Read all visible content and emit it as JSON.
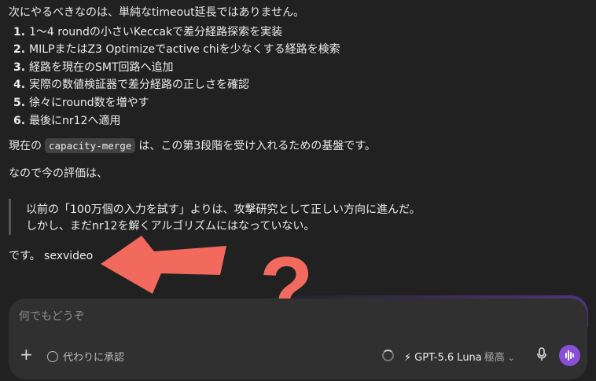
{
  "message": {
    "intro": "次にやるべきなのは、単純なtimeout延長ではありません。",
    "steps": [
      {
        "num": "1.",
        "text": "1〜4 roundの小さいKeccakで差分経路探索を実装"
      },
      {
        "num": "2.",
        "text": "MILPまたはZ3 Optimizeでactive chiを少なくする経路を検索"
      },
      {
        "num": "3.",
        "text": "経路を現在のSMT回路へ追加"
      },
      {
        "num": "4.",
        "text": "実際の数値検証器で差分経路の正しさを確認"
      },
      {
        "num": "5.",
        "text": "徐々にround数を増やす"
      },
      {
        "num": "6.",
        "text": "最後にnr12へ適用"
      }
    ],
    "current_before": "現在の",
    "current_code": "capacity-merge",
    "current_after": "は、この第3段階を受け入れるための基盤です。",
    "evaluation_intro": "なので今の評価は、",
    "quote_lines": [
      "以前の「100万個の入力を試す」よりは、攻撃研究として正しい方向に進んだ。",
      "しかし、まだnr12を解くアルゴリズムにはなっていない。"
    ],
    "closing": "です。 sexvideo"
  },
  "annotation": {
    "arrow_color": "#f26a5d",
    "question_mark": "?"
  },
  "composer": {
    "placeholder": "何でもどうぞ",
    "approve_label": "代わりに承認",
    "model_label": "GPT-5.6 Luna",
    "model_level": "極高",
    "icons": [
      "plus-icon",
      "approve-icon",
      "spinner-icon",
      "bolt-icon",
      "chevron-down-icon",
      "mic-icon",
      "voice-icon"
    ],
    "voice_color": "#8a4fd8"
  }
}
